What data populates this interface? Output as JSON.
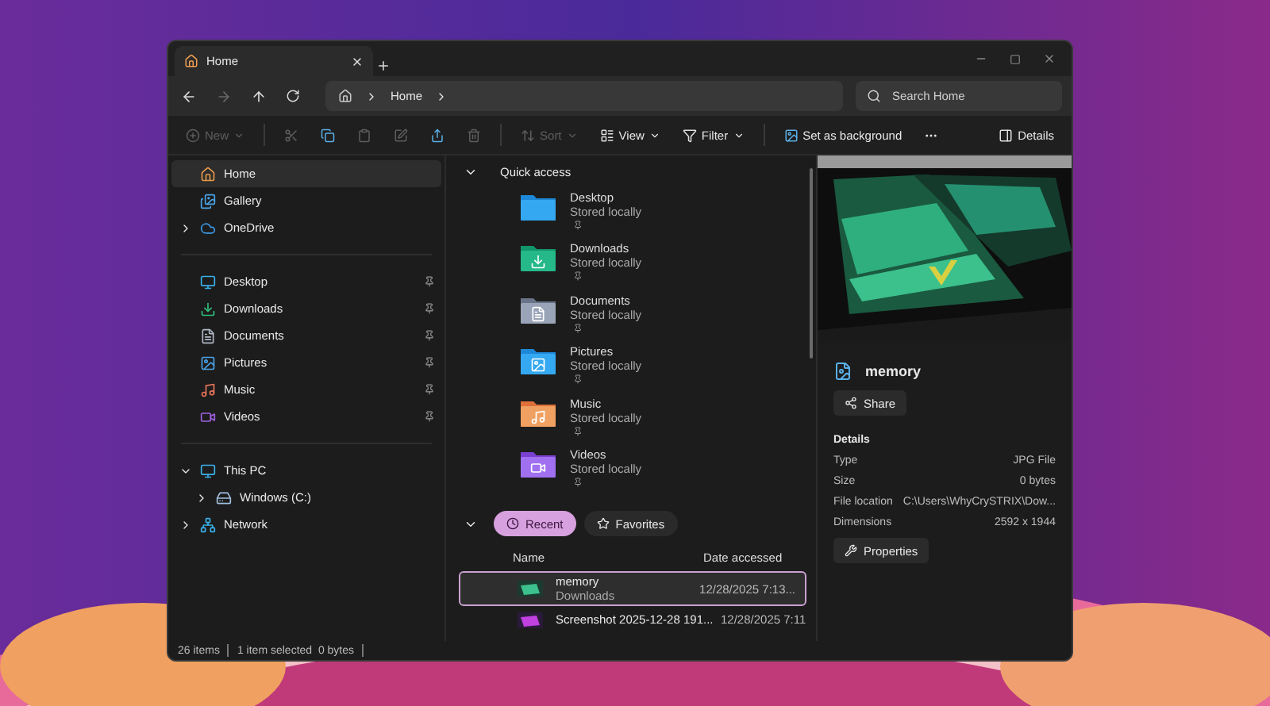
{
  "tab": {
    "title": "Home"
  },
  "address": {
    "crumbs": [
      "Home"
    ]
  },
  "search": {
    "placeholder": "Search Home"
  },
  "commands": [
    {
      "label": "New",
      "disabled": true,
      "dropdown": true
    },
    {
      "disabled": true
    },
    {
      "disabled": false
    },
    {
      "disabled": true
    },
    {
      "disabled": true
    },
    {
      "disabled": false
    },
    {
      "disabled": true
    },
    {
      "label": "Sort",
      "disabled": true,
      "dropdown": true
    },
    {
      "label": "View",
      "disabled": false,
      "dropdown": true
    },
    {
      "label": "Filter",
      "disabled": false,
      "dropdown": true
    },
    {
      "label": "Set as background",
      "disabled": false,
      "dropdown": false
    },
    {
      "disabled": false
    },
    {
      "label": "Details",
      "disabled": false,
      "dropdown": false
    }
  ],
  "sidebar": {
    "groups": [
      {
        "items": [
          {
            "label": "Home",
            "selected": true
          },
          {
            "label": "Gallery",
            "selected": false
          },
          {
            "label": "OneDrive",
            "selected": false,
            "expanded": false
          }
        ]
      },
      {
        "items": [
          {
            "label": "Desktop",
            "selected": false,
            "pinned": true
          },
          {
            "label": "Downloads",
            "selected": false,
            "pinned": true
          },
          {
            "label": "Documents",
            "selected": false,
            "pinned": true
          },
          {
            "label": "Pictures",
            "selected": false,
            "pinned": true
          },
          {
            "label": "Music",
            "selected": false,
            "pinned": true
          },
          {
            "label": "Videos",
            "selected": false,
            "pinned": true
          }
        ]
      },
      {
        "items": [
          {
            "label": "This PC",
            "selected": false,
            "expanded": true,
            "children": [
              {
                "label": "Windows (C:)",
                "selected": false,
                "expanded": false
              }
            ]
          },
          {
            "label": "Network",
            "selected": false,
            "expanded": false
          }
        ]
      }
    ]
  },
  "quick_access": {
    "title": "Quick access",
    "expanded": true,
    "items": [
      {
        "name": "Desktop",
        "status": "Stored locally",
        "pinned": true
      },
      {
        "name": "Downloads",
        "status": "Stored locally",
        "pinned": true
      },
      {
        "name": "Documents",
        "status": "Stored locally",
        "pinned": true
      },
      {
        "name": "Pictures",
        "status": "Stored locally",
        "pinned": true
      },
      {
        "name": "Music",
        "status": "Stored locally",
        "pinned": true
      },
      {
        "name": "Videos",
        "status": "Stored locally",
        "pinned": true
      }
    ]
  },
  "recent": {
    "expanded": true,
    "tabs": [
      {
        "label": "Recent",
        "selected": true
      },
      {
        "label": "Favorites",
        "selected": false
      }
    ],
    "columns": [
      "Name",
      "Date accessed"
    ],
    "rows": [
      {
        "name": "memory",
        "location": "Downloads",
        "date": "12/28/2025 7:13...",
        "selected": true
      },
      {
        "name": "Screenshot 2025-12-28 191...",
        "date": "12/28/2025 7:11",
        "selected": false
      }
    ]
  },
  "details": {
    "file_name": "memory",
    "share": "Share",
    "heading": "Details",
    "properties": [
      {
        "label": "Type",
        "value": "JPG File"
      },
      {
        "label": "Size",
        "value": "0 bytes"
      },
      {
        "label": "File location",
        "value": "C:\\Users\\WhyCrySTRIX\\Dow..."
      },
      {
        "label": "Dimensions",
        "value": "2592 x 1944"
      }
    ],
    "properties_button": "Properties"
  },
  "status_bar": {
    "count": "26 items",
    "selection": "1 item selected  0 bytes"
  }
}
